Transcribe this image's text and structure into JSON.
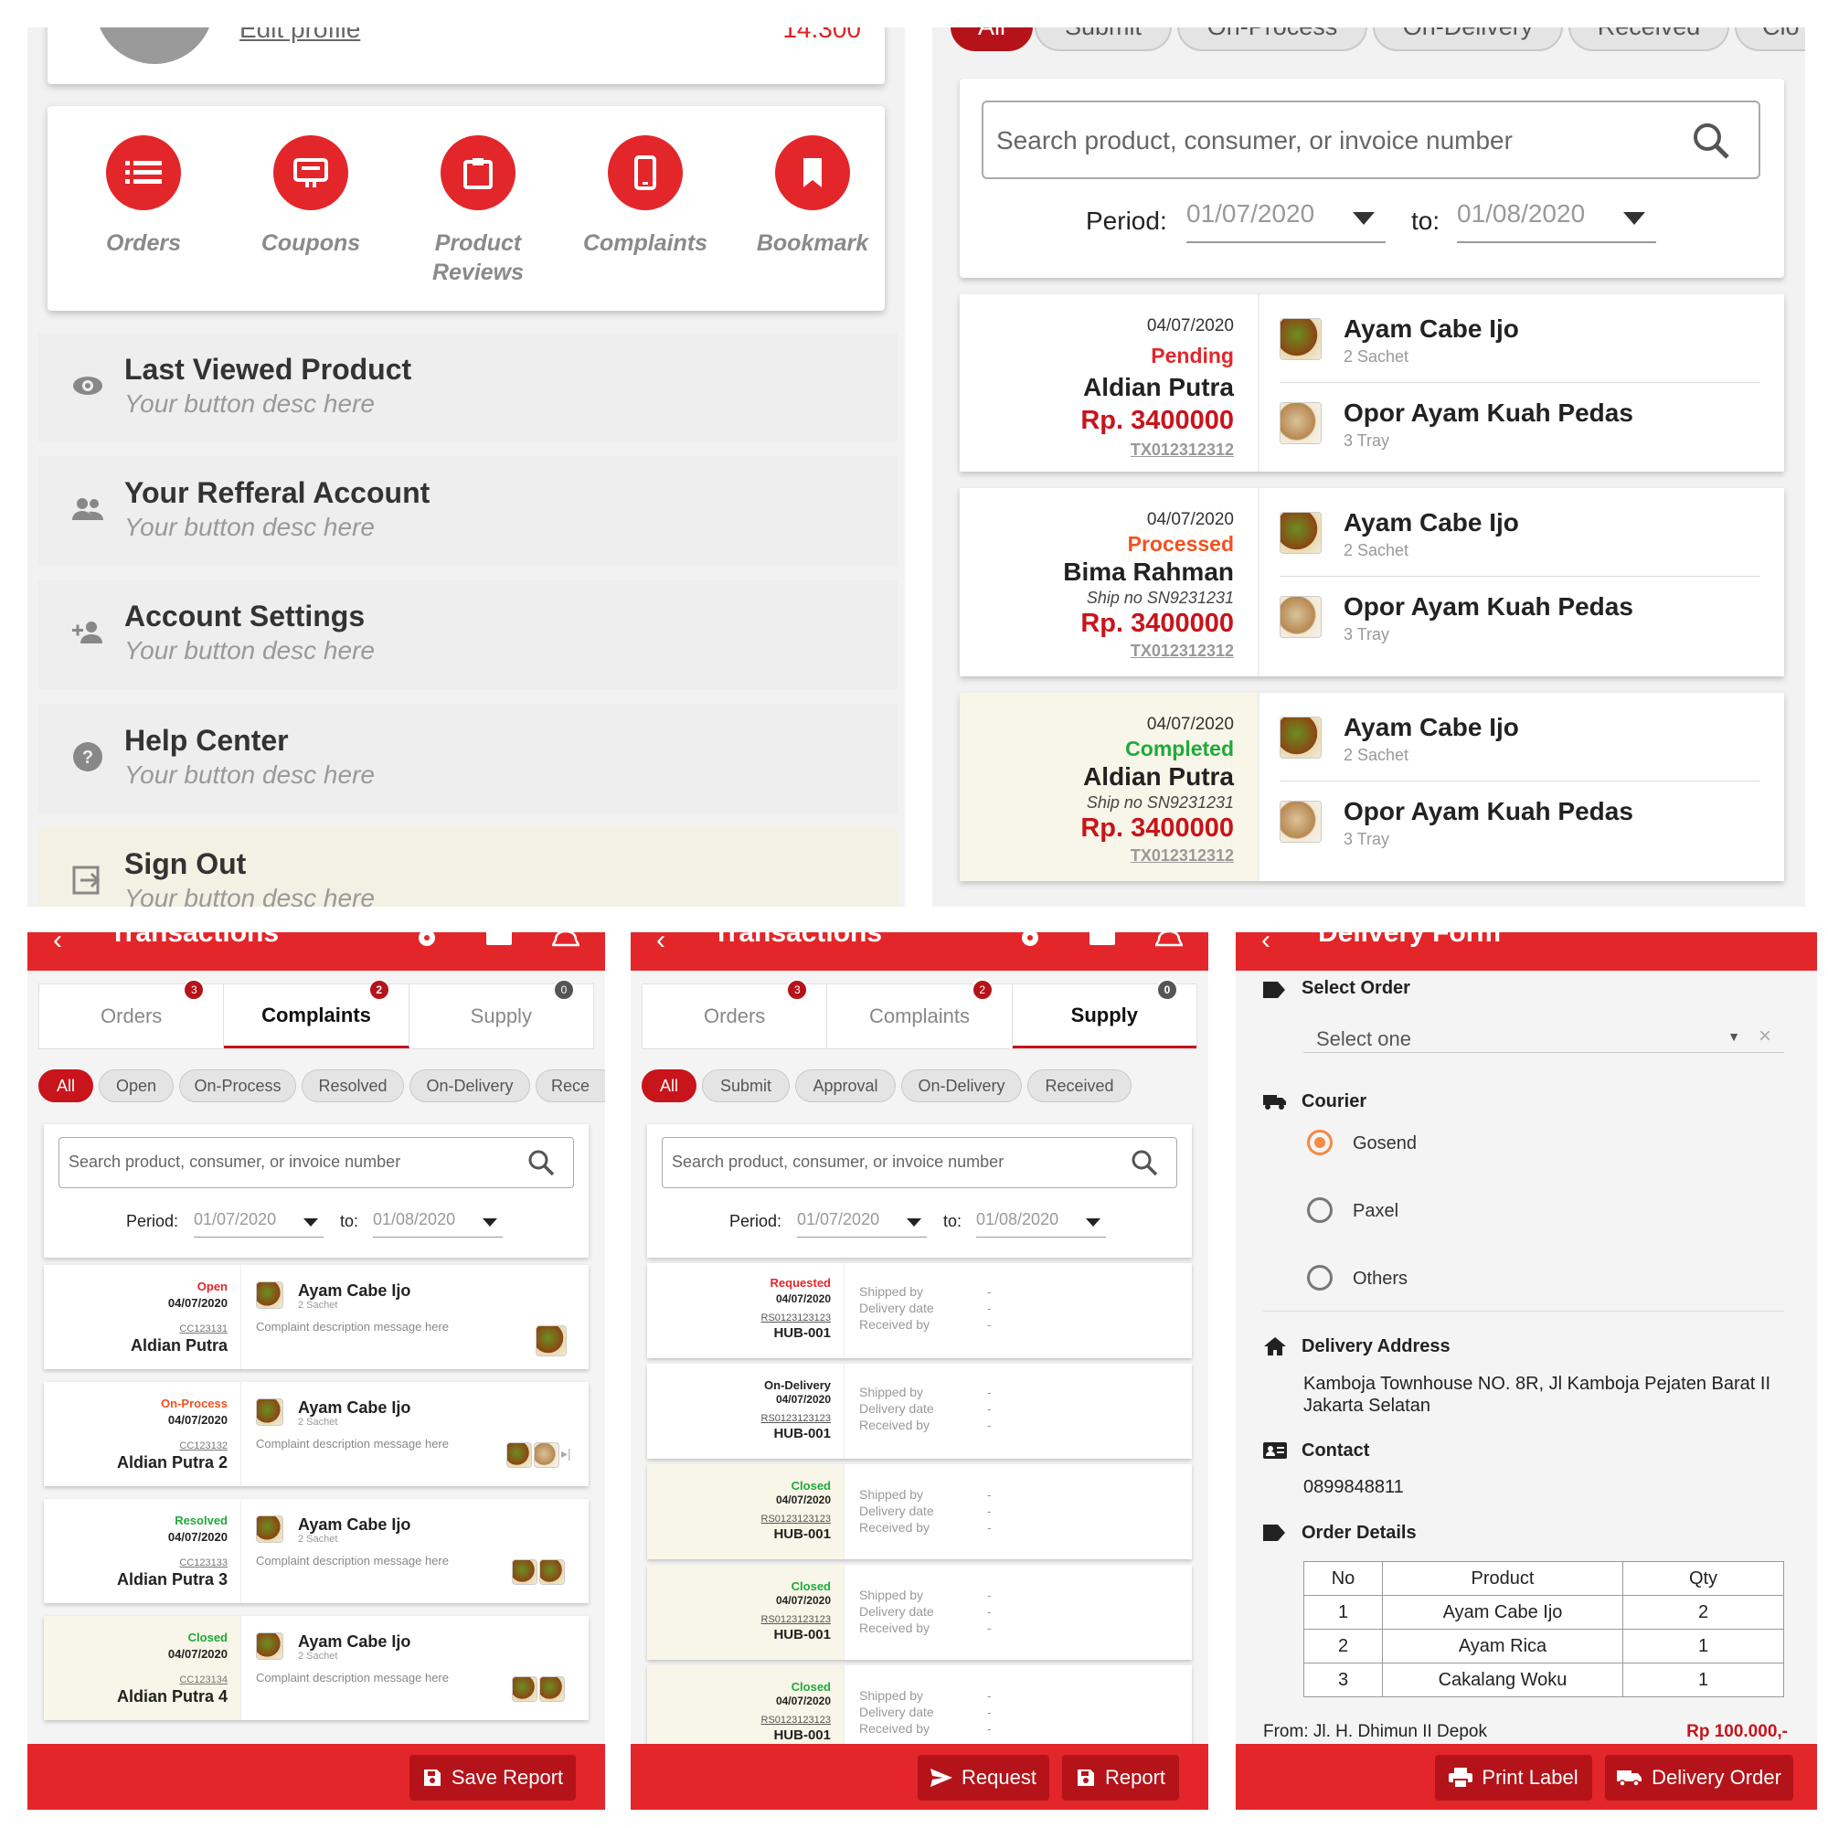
{
  "profile": {
    "edit_link": "Edit profile",
    "points": "14.300",
    "menu": [
      {
        "label": "Orders",
        "icon": "list-icon"
      },
      {
        "label": "Coupons",
        "icon": "coupon-icon"
      },
      {
        "label": "Product Reviews",
        "icon": "clipboard-icon"
      },
      {
        "label": "Complaints",
        "icon": "phone-icon"
      },
      {
        "label": "Bookmark",
        "icon": "bookmark-icon"
      }
    ],
    "rows": [
      {
        "title": "Last Viewed Product",
        "desc": "Your button desc here",
        "icon": "eye-icon"
      },
      {
        "title": "Your Refferal Account",
        "desc": "Your button desc here",
        "icon": "people-icon"
      },
      {
        "title": "Account Settings",
        "desc": "Your button desc here",
        "icon": "add-person-icon"
      },
      {
        "title": "Help Center",
        "desc": "Your button desc here",
        "icon": "help-icon"
      },
      {
        "title": "Sign Out",
        "desc": "Your button desc here",
        "icon": "sign-out-icon"
      }
    ]
  },
  "orders": {
    "chips": [
      "All",
      "Submit",
      "On-Process",
      "On-Delivery",
      "Received",
      "Clo"
    ],
    "search_placeholder": "Search product, consumer, or invoice number",
    "period_label": "Period:",
    "period_from": "01/07/2020",
    "to_label": "to:",
    "period_to": "01/08/2020",
    "list": [
      {
        "date": "04/07/2020",
        "status": "Pending",
        "status_color": "#e3262a",
        "name": "Aldian Putra",
        "ship": "",
        "price": "Rp. 3400000",
        "invoice": "TX012312312",
        "items": [
          {
            "name": "Ayam Cabe Ijo",
            "qty": "2 Sachet"
          },
          {
            "name": "Opor Ayam Kuah Pedas",
            "qty": "3 Tray"
          }
        ]
      },
      {
        "date": "04/07/2020",
        "status": "Processed",
        "status_color": "#f0521f",
        "name": "Bima Rahman",
        "ship": "Ship no SN9231231",
        "price": "Rp. 3400000",
        "invoice": "TX012312312",
        "items": [
          {
            "name": "Ayam Cabe Ijo",
            "qty": "2 Sachet"
          },
          {
            "name": "Opor Ayam Kuah Pedas",
            "qty": "3 Tray"
          }
        ]
      },
      {
        "date": "04/07/2020",
        "status": "Completed",
        "status_color": "#1faa3a",
        "name": "Aldian Putra",
        "ship": "Ship no SN9231231",
        "price": "Rp. 3400000",
        "invoice": "TX012312312",
        "items": [
          {
            "name": "Ayam Cabe Ijo",
            "qty": "2 Sachet"
          },
          {
            "name": "Opor Ayam Kuah Pedas",
            "qty": "3 Tray"
          }
        ]
      }
    ]
  },
  "complaints": {
    "title": "Transactions",
    "tabs": [
      {
        "label": "Orders",
        "badge": "3"
      },
      {
        "label": "Complaints",
        "badge": "2"
      },
      {
        "label": "Supply",
        "badge": "0"
      }
    ],
    "chips": [
      "All",
      "Open",
      "On-Process",
      "Resolved",
      "On-Delivery",
      "Rece"
    ],
    "search_placeholder": "Search product, consumer, or invoice number",
    "period_label": "Period:",
    "period_from": "01/07/2020",
    "to_label": "to:",
    "period_to": "01/08/2020",
    "list": [
      {
        "status": "Open",
        "status_color": "#e3262a",
        "date": "04/07/2020",
        "code": "CC123131",
        "name": "Aldian Putra",
        "product": "Ayam Cabe Ijo",
        "qty": "2 Sachet",
        "desc": "Complaint description message here"
      },
      {
        "status": "On-Process",
        "status_color": "#f0521f",
        "date": "04/07/2020",
        "code": "CC123132",
        "name": "Aldian Putra 2",
        "product": "Ayam Cabe Ijo",
        "qty": "2 Sachet",
        "desc": "Complaint description message here"
      },
      {
        "status": "Resolved",
        "status_color": "#1faa3a",
        "date": "04/07/2020",
        "code": "CC123133",
        "name": "Aldian Putra 3",
        "product": "Ayam Cabe Ijo",
        "qty": "2 Sachet",
        "desc": "Complaint description message here"
      },
      {
        "status": "Closed",
        "status_color": "#1faa3a",
        "date": "04/07/2020",
        "code": "CC123134",
        "name": "Aldian Putra 4",
        "product": "Ayam Cabe Ijo",
        "qty": "2 Sachet",
        "desc": "Complaint description message here"
      }
    ],
    "save_label": "Save Report"
  },
  "supply": {
    "title": "Transactions",
    "tabs": [
      {
        "label": "Orders",
        "badge": "3"
      },
      {
        "label": "Complaints",
        "badge": "2"
      },
      {
        "label": "Supply",
        "badge": "0"
      }
    ],
    "chips": [
      "All",
      "Submit",
      "Approval",
      "On-Delivery",
      "Received"
    ],
    "search_placeholder": "Search product, consumer, or invoice number",
    "period_label": "Period:",
    "period_from": "01/07/2020",
    "to_label": "to:",
    "period_to": "01/08/2020",
    "field_labels": [
      "Shipped by",
      "Delivery date",
      "Received by"
    ],
    "dash": "-",
    "list": [
      {
        "status": "Requested",
        "status_color": "#e3262a",
        "date": "04/07/2020",
        "code": "RS0123123123",
        "hub": "HUB-001"
      },
      {
        "status": "On-Delivery",
        "status_color": "#222222",
        "date": "04/07/2020",
        "code": "RS0123123123",
        "hub": "HUB-001"
      },
      {
        "status": "Closed",
        "status_color": "#1faa3a",
        "date": "04/07/2020",
        "code": "RS0123123123",
        "hub": "HUB-001"
      },
      {
        "status": "Closed",
        "status_color": "#1faa3a",
        "date": "04/07/2020",
        "code": "RS0123123123",
        "hub": "HUB-001"
      },
      {
        "status": "Closed",
        "status_color": "#1faa3a",
        "date": "04/07/2020",
        "code": "RS0123123123",
        "hub": "HUB-001"
      }
    ],
    "request_label": "Request",
    "report_label": "Report"
  },
  "delivery": {
    "title": "Delivery Form",
    "select_order_label": "Select Order",
    "select_placeholder": "Select one",
    "courier_label": "Courier",
    "couriers": [
      "Gosend",
      "Paxel",
      "Others"
    ],
    "courier_selected": "Gosend",
    "address_label": "Delivery Address",
    "address": "Kamboja Townhouse NO. 8R, Jl Kamboja Pejaten Barat II Jakarta Selatan",
    "contact_label": "Contact",
    "contact": "0899848811",
    "details_label": "Order Details",
    "table_headers": [
      "No",
      "Product",
      "Qty"
    ],
    "table_rows": [
      [
        "1",
        "Ayam Cabe Ijo",
        "2"
      ],
      [
        "2",
        "Ayam Rica",
        "1"
      ],
      [
        "3",
        "Cakalang Woku",
        "1"
      ]
    ],
    "from": "From: Jl. H. Dhimun II Depok",
    "total": "Rp 100.000,-",
    "print_label": "Print Label",
    "delivery_order_label": "Delivery Order"
  },
  "colors": {
    "brand_red": "#e3262a",
    "dark_red": "#b5131a",
    "pending_bg": "#f7f6e8"
  }
}
